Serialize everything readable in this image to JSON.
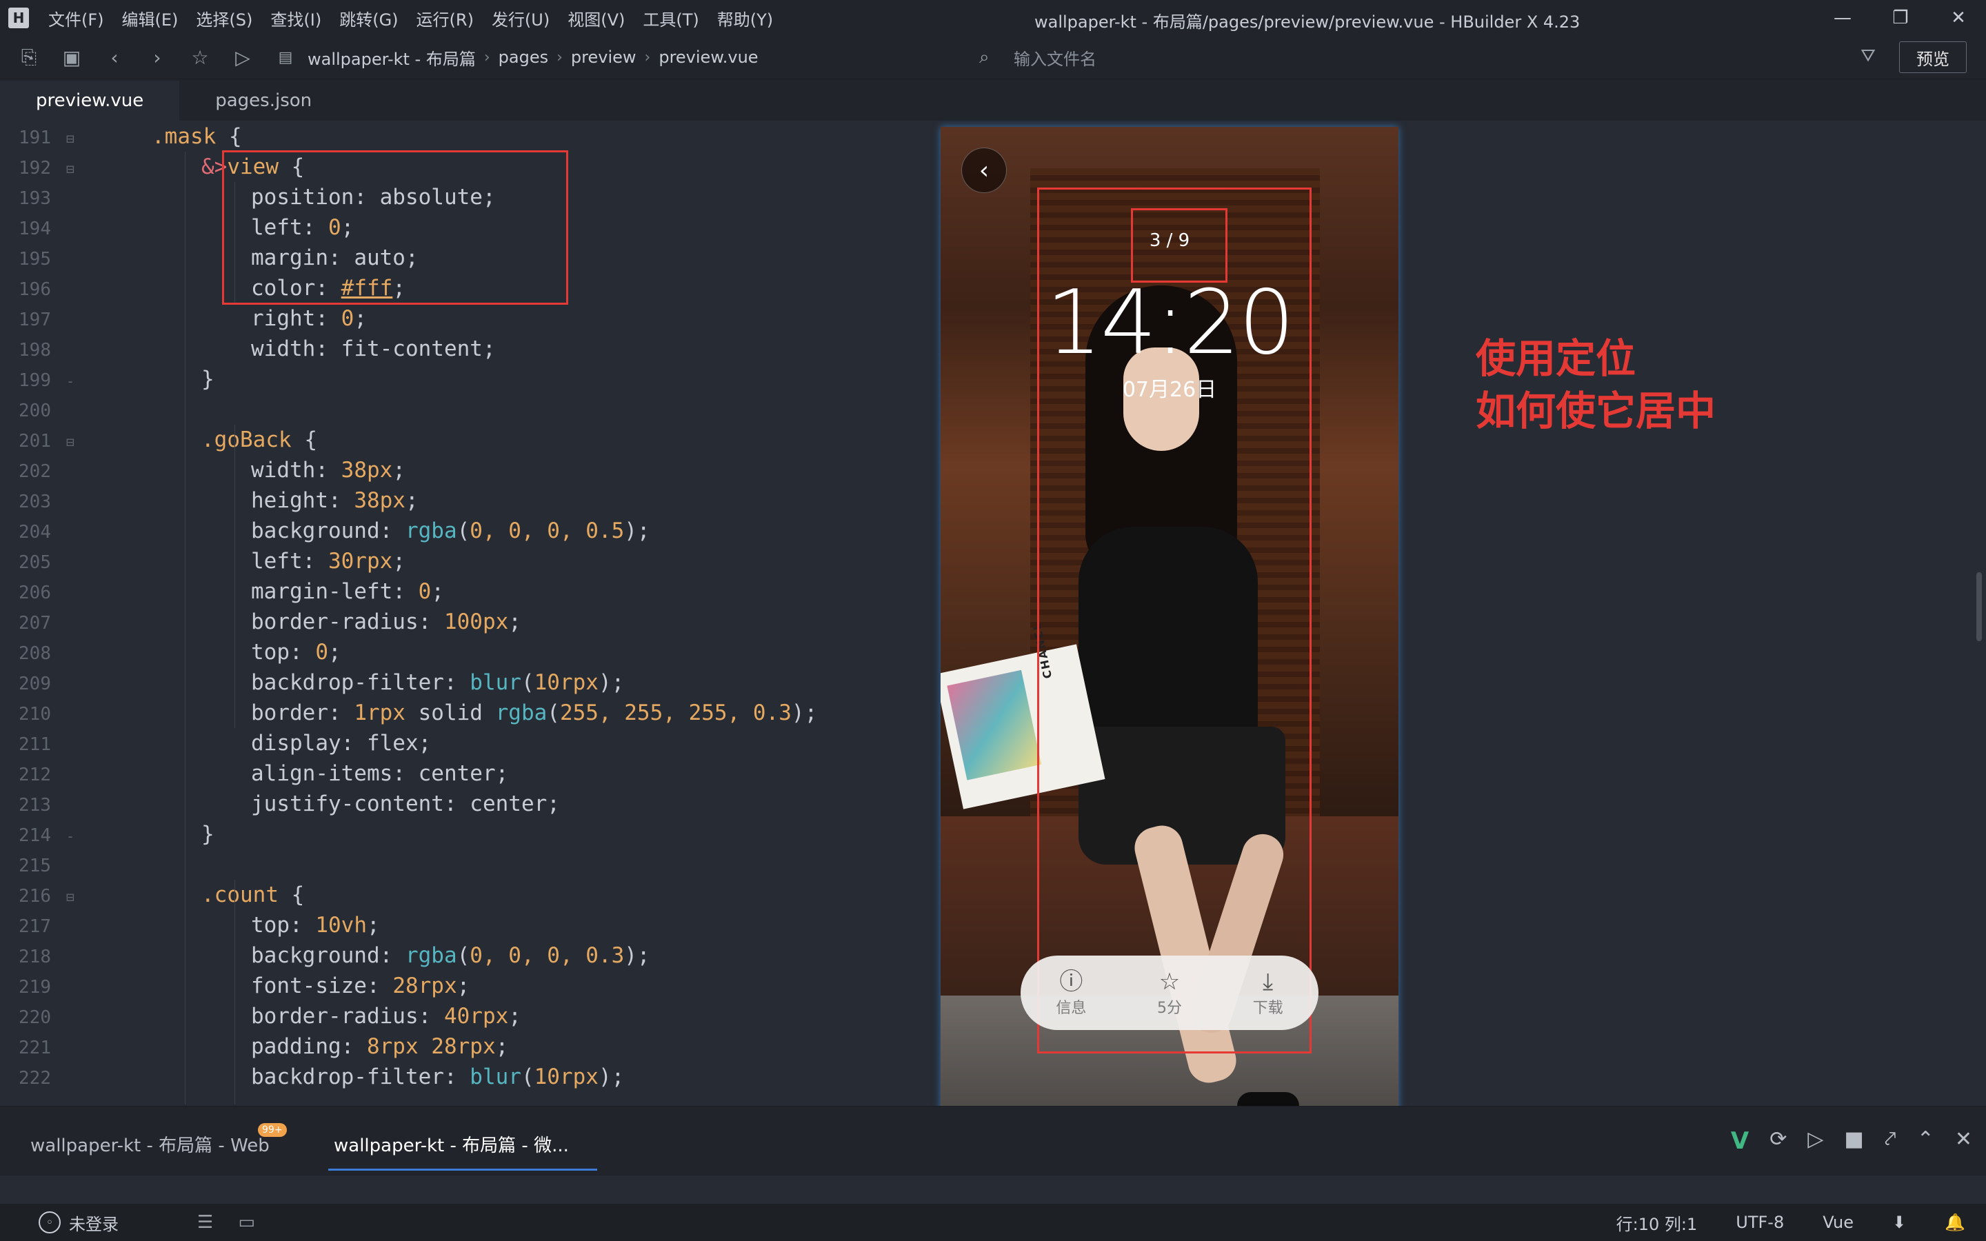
{
  "window": {
    "logo": "H",
    "title": "wallpaper-kt - 布局篇/pages/preview/preview.vue - HBuilder X 4.23",
    "menu": [
      "文件(F)",
      "编辑(E)",
      "选择(S)",
      "查找(I)",
      "跳转(G)",
      "运行(R)",
      "发行(U)",
      "视图(V)",
      "工具(T)",
      "帮助(Y)"
    ],
    "controls": {
      "minimize": "—",
      "maximize": "❐",
      "close": "✕"
    }
  },
  "toolbar": {
    "breadcrumb": [
      "wallpaper-kt - 布局篇",
      "pages",
      "preview",
      "preview.vue"
    ],
    "search_placeholder": "输入文件名",
    "preview_label": "预览"
  },
  "tabs": [
    "preview.vue",
    "pages.json"
  ],
  "code": {
    "lines": [
      {
        "n": "191",
        "fold": "⊟",
        "indent": 0,
        "parts": [
          [
            ".mask ",
            "sel"
          ],
          [
            "{",
            "val"
          ]
        ]
      },
      {
        "n": "192",
        "fold": "⊟",
        "indent": 1,
        "parts": [
          [
            "&>",
            "amp"
          ],
          [
            "view ",
            "sel"
          ],
          [
            "{",
            "val"
          ]
        ]
      },
      {
        "n": "193",
        "fold": "",
        "indent": 2,
        "parts": [
          [
            "position",
            "prop"
          ],
          [
            ": ",
            "val"
          ],
          [
            "absolute",
            "val"
          ],
          [
            ";",
            "val"
          ]
        ]
      },
      {
        "n": "194",
        "fold": "",
        "indent": 2,
        "parts": [
          [
            "left",
            "prop"
          ],
          [
            ": ",
            "val"
          ],
          [
            "0",
            "num"
          ],
          [
            ";",
            "val"
          ]
        ]
      },
      {
        "n": "195",
        "fold": "",
        "indent": 2,
        "parts": [
          [
            "margin",
            "prop"
          ],
          [
            ": ",
            "val"
          ],
          [
            "auto",
            "val"
          ],
          [
            ";",
            "val"
          ]
        ]
      },
      {
        "n": "196",
        "fold": "",
        "indent": 2,
        "parts": [
          [
            "color",
            "prop"
          ],
          [
            ": ",
            "val"
          ],
          [
            "#fff",
            "hex"
          ],
          [
            ";",
            "val"
          ]
        ]
      },
      {
        "n": "197",
        "fold": "",
        "indent": 2,
        "parts": [
          [
            "right",
            "prop"
          ],
          [
            ": ",
            "val"
          ],
          [
            "0",
            "num"
          ],
          [
            ";",
            "val"
          ]
        ]
      },
      {
        "n": "198",
        "fold": "",
        "indent": 2,
        "parts": [
          [
            "width",
            "prop"
          ],
          [
            ": ",
            "val"
          ],
          [
            "fit-content",
            "val"
          ],
          [
            ";",
            "val"
          ]
        ]
      },
      {
        "n": "199",
        "fold": "-",
        "indent": 1,
        "parts": [
          [
            "}",
            "val"
          ]
        ]
      },
      {
        "n": "200",
        "fold": "",
        "indent": 1,
        "parts": []
      },
      {
        "n": "201",
        "fold": "⊟",
        "indent": 1,
        "parts": [
          [
            ".goBack ",
            "sel"
          ],
          [
            "{",
            "val"
          ]
        ]
      },
      {
        "n": "202",
        "fold": "",
        "indent": 2,
        "parts": [
          [
            "width",
            "prop"
          ],
          [
            ": ",
            "val"
          ],
          [
            "38px",
            "num"
          ],
          [
            ";",
            "val"
          ]
        ]
      },
      {
        "n": "203",
        "fold": "",
        "indent": 2,
        "parts": [
          [
            "height",
            "prop"
          ],
          [
            ": ",
            "val"
          ],
          [
            "38px",
            "num"
          ],
          [
            ";",
            "val"
          ]
        ]
      },
      {
        "n": "204",
        "fold": "",
        "indent": 2,
        "parts": [
          [
            "background",
            "prop"
          ],
          [
            ": ",
            "val"
          ],
          [
            "rgba",
            "fn"
          ],
          [
            "(",
            "val"
          ],
          [
            "0, 0, 0, 0.5",
            "num"
          ],
          [
            ");",
            "val"
          ]
        ]
      },
      {
        "n": "205",
        "fold": "",
        "indent": 2,
        "parts": [
          [
            "left",
            "prop"
          ],
          [
            ": ",
            "val"
          ],
          [
            "30rpx",
            "num"
          ],
          [
            ";",
            "val"
          ]
        ]
      },
      {
        "n": "206",
        "fold": "",
        "indent": 2,
        "parts": [
          [
            "margin-left",
            "prop"
          ],
          [
            ": ",
            "val"
          ],
          [
            "0",
            "num"
          ],
          [
            ";",
            "val"
          ]
        ]
      },
      {
        "n": "207",
        "fold": "",
        "indent": 2,
        "parts": [
          [
            "border-radius",
            "prop"
          ],
          [
            ": ",
            "val"
          ],
          [
            "100px",
            "num"
          ],
          [
            ";",
            "val"
          ]
        ]
      },
      {
        "n": "208",
        "fold": "",
        "indent": 2,
        "parts": [
          [
            "top",
            "prop"
          ],
          [
            ": ",
            "val"
          ],
          [
            "0",
            "num"
          ],
          [
            ";",
            "val"
          ]
        ]
      },
      {
        "n": "209",
        "fold": "",
        "indent": 2,
        "parts": [
          [
            "backdrop-filter",
            "prop"
          ],
          [
            ": ",
            "val"
          ],
          [
            "blur",
            "fn"
          ],
          [
            "(",
            "val"
          ],
          [
            "10rpx",
            "num"
          ],
          [
            ");",
            "val"
          ]
        ]
      },
      {
        "n": "210",
        "fold": "",
        "indent": 2,
        "parts": [
          [
            "border",
            "prop"
          ],
          [
            ": ",
            "val"
          ],
          [
            "1rpx",
            "num"
          ],
          [
            " solid ",
            "val"
          ],
          [
            "rgba",
            "fn"
          ],
          [
            "(",
            "val"
          ],
          [
            "255, 255, 255, 0.3",
            "num"
          ],
          [
            ");",
            "val"
          ]
        ]
      },
      {
        "n": "211",
        "fold": "",
        "indent": 2,
        "parts": [
          [
            "display",
            "prop"
          ],
          [
            ": ",
            "val"
          ],
          [
            "flex",
            "val"
          ],
          [
            ";",
            "val"
          ]
        ]
      },
      {
        "n": "212",
        "fold": "",
        "indent": 2,
        "parts": [
          [
            "align-items",
            "prop"
          ],
          [
            ": ",
            "val"
          ],
          [
            "center",
            "val"
          ],
          [
            ";",
            "val"
          ]
        ]
      },
      {
        "n": "213",
        "fold": "",
        "indent": 2,
        "parts": [
          [
            "justify-content",
            "prop"
          ],
          [
            ": ",
            "val"
          ],
          [
            "center",
            "val"
          ],
          [
            ";",
            "val"
          ]
        ]
      },
      {
        "n": "214",
        "fold": "-",
        "indent": 1,
        "parts": [
          [
            "}",
            "val"
          ]
        ]
      },
      {
        "n": "215",
        "fold": "",
        "indent": 1,
        "parts": []
      },
      {
        "n": "216",
        "fold": "⊟",
        "indent": 1,
        "parts": [
          [
            ".count ",
            "sel"
          ],
          [
            "{",
            "val"
          ]
        ]
      },
      {
        "n": "217",
        "fold": "",
        "indent": 2,
        "parts": [
          [
            "top",
            "prop"
          ],
          [
            ": ",
            "val"
          ],
          [
            "10vh",
            "num"
          ],
          [
            ";",
            "val"
          ]
        ]
      },
      {
        "n": "218",
        "fold": "",
        "indent": 2,
        "parts": [
          [
            "background",
            "prop"
          ],
          [
            ": ",
            "val"
          ],
          [
            "rgba",
            "fn"
          ],
          [
            "(",
            "val"
          ],
          [
            "0, 0, 0, 0.3",
            "num"
          ],
          [
            ");",
            "val"
          ]
        ]
      },
      {
        "n": "219",
        "fold": "",
        "indent": 2,
        "parts": [
          [
            "font-size",
            "prop"
          ],
          [
            ": ",
            "val"
          ],
          [
            "28rpx",
            "num"
          ],
          [
            ";",
            "val"
          ]
        ]
      },
      {
        "n": "220",
        "fold": "",
        "indent": 2,
        "parts": [
          [
            "border-radius",
            "prop"
          ],
          [
            ": ",
            "val"
          ],
          [
            "40rpx",
            "num"
          ],
          [
            ";",
            "val"
          ]
        ]
      },
      {
        "n": "221",
        "fold": "",
        "indent": 2,
        "parts": [
          [
            "padding",
            "prop"
          ],
          [
            ": ",
            "val"
          ],
          [
            "8rpx 28rpx",
            "num"
          ],
          [
            ";",
            "val"
          ]
        ]
      },
      {
        "n": "222",
        "fold": "",
        "indent": 2,
        "parts": [
          [
            "backdrop-filter",
            "prop"
          ],
          [
            ": ",
            "val"
          ],
          [
            "blur",
            "fn"
          ],
          [
            "(",
            "val"
          ],
          [
            "10rpx",
            "num"
          ],
          [
            ");",
            "val"
          ]
        ]
      }
    ]
  },
  "preview": {
    "back_icon": "‹",
    "count": "3 / 9",
    "clock": "14:20",
    "date": "07月26日",
    "book_brand": "CHANEL",
    "footer": [
      {
        "icon": "ⓘ",
        "label": "信息",
        "icon_name": "info-icon"
      },
      {
        "icon": "☆",
        "label": "5分",
        "icon_name": "star-icon"
      },
      {
        "icon": "⤓",
        "label": "下载",
        "icon_name": "download-icon"
      }
    ]
  },
  "annotation": {
    "line1": "使用定位",
    "line2": "如何使它居中"
  },
  "bottom_panel": {
    "tab1": "wallpaper-kt - 布局篇 - Web",
    "badge": "99+",
    "tab2": "wallpaper-kt - 布局篇 - 微..."
  },
  "statusbar": {
    "user": "未登录",
    "position": "行:10  列:1",
    "encoding": "UTF-8",
    "language": "Vue"
  },
  "colors": {
    "annotation_red": "#e53935",
    "selector": "#e5a961",
    "function": "#56b6c2",
    "editor_bg": "#272b33"
  }
}
